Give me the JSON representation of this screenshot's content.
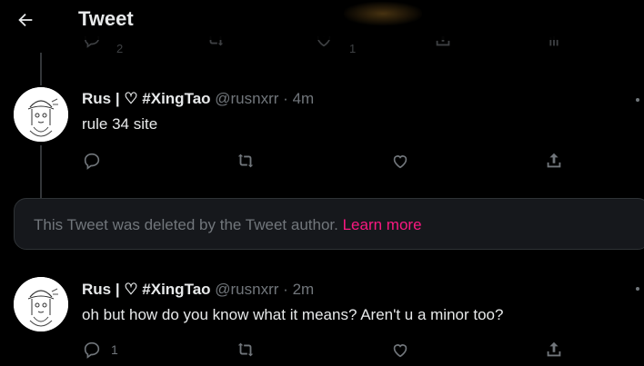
{
  "header": {
    "title": "Tweet"
  },
  "faded_row": {
    "reply_count": "2",
    "like_count": "1"
  },
  "tweets": [
    {
      "name": "Rus | ♡ #XingTao",
      "handle": "@rusnxrr",
      "separator": "·",
      "time": "4m",
      "text": "rule 34 site",
      "reply_count": "",
      "avatar_icon": "sketch-avatar"
    },
    {
      "name": "Rus | ♡ #XingTao",
      "handle": "@rusnxrr",
      "separator": "·",
      "time": "2m",
      "text": "oh but how do you know what it means? Aren't u a minor too?",
      "reply_count": "1",
      "avatar_icon": "sketch-avatar"
    }
  ],
  "deleted_notice": {
    "text": "This Tweet was deleted by the Tweet author.",
    "link": "Learn more"
  },
  "colors": {
    "background": "#000000",
    "text": "#e7e9ea",
    "secondary": "#71767b",
    "link": "#f91880",
    "card": "#16181c"
  }
}
